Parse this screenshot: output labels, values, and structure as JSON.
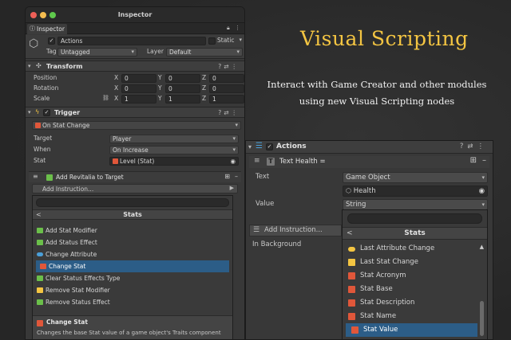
{
  "hero": {
    "title": "Visual Scripting",
    "subtitle": "Interact with Game Creator and other modules using new Visual Scripting nodes"
  },
  "inspector": {
    "window_title": "Inspector",
    "tab_label": "Inspector",
    "object": {
      "name": "Actions",
      "static_label": "Static",
      "tag_label": "Tag",
      "tag_value": "Untagged",
      "layer_label": "Layer",
      "layer_value": "Default"
    },
    "transform": {
      "title": "Transform",
      "rows": [
        {
          "label": "Position",
          "x": "0",
          "y": "0",
          "z": "0"
        },
        {
          "label": "Rotation",
          "x": "0",
          "y": "0",
          "z": "0"
        },
        {
          "label": "Scale",
          "x": "1",
          "y": "1",
          "z": "1"
        }
      ],
      "axis": {
        "x": "X",
        "y": "Y",
        "z": "Z"
      }
    },
    "trigger": {
      "title": "Trigger",
      "event": "On Stat Change",
      "fields": [
        {
          "label": "Target",
          "value": "Player"
        },
        {
          "label": "When",
          "value": "On Increase"
        },
        {
          "label": "Stat",
          "value": "Level (Stat)"
        }
      ],
      "instruction": "Add Revitalia to Target",
      "add_instruction": "Add Instruction..."
    },
    "stats_popup": {
      "title": "Stats",
      "back": "<",
      "items": [
        "Add Stat Modifier",
        "Add Status Effect",
        "Change Attribute",
        "Change Stat",
        "Clear Status Effects Type",
        "Remove Stat Modifier",
        "Remove Status Effect"
      ],
      "selected_index": 3,
      "footer_title": "Change Stat",
      "footer_desc": "Changes the base Stat value of a game object's Traits component"
    }
  },
  "actions_panel": {
    "title": "Actions",
    "node_title": "Text Health =",
    "text_label": "Text",
    "text_type": "Game Object",
    "text_value": "Health",
    "value_label": "Value",
    "value_type": "String",
    "add_instruction": "Add Instruction...",
    "in_background": "In Background",
    "stats_popup": {
      "title": "Stats",
      "back": "<",
      "items": [
        "Last Attribute Change",
        "Last Stat Change",
        "Stat Acronym",
        "Stat Base",
        "Stat Description",
        "Stat Name",
        "Stat Value"
      ],
      "selected_index": 6
    }
  },
  "colors": {
    "accent_yellow": "#f4c542",
    "selected_blue": "#2c5d87",
    "stat_orange": "#e0573a",
    "effect_green": "#6bbf4a",
    "attr_blue": "#4a9fd8"
  }
}
